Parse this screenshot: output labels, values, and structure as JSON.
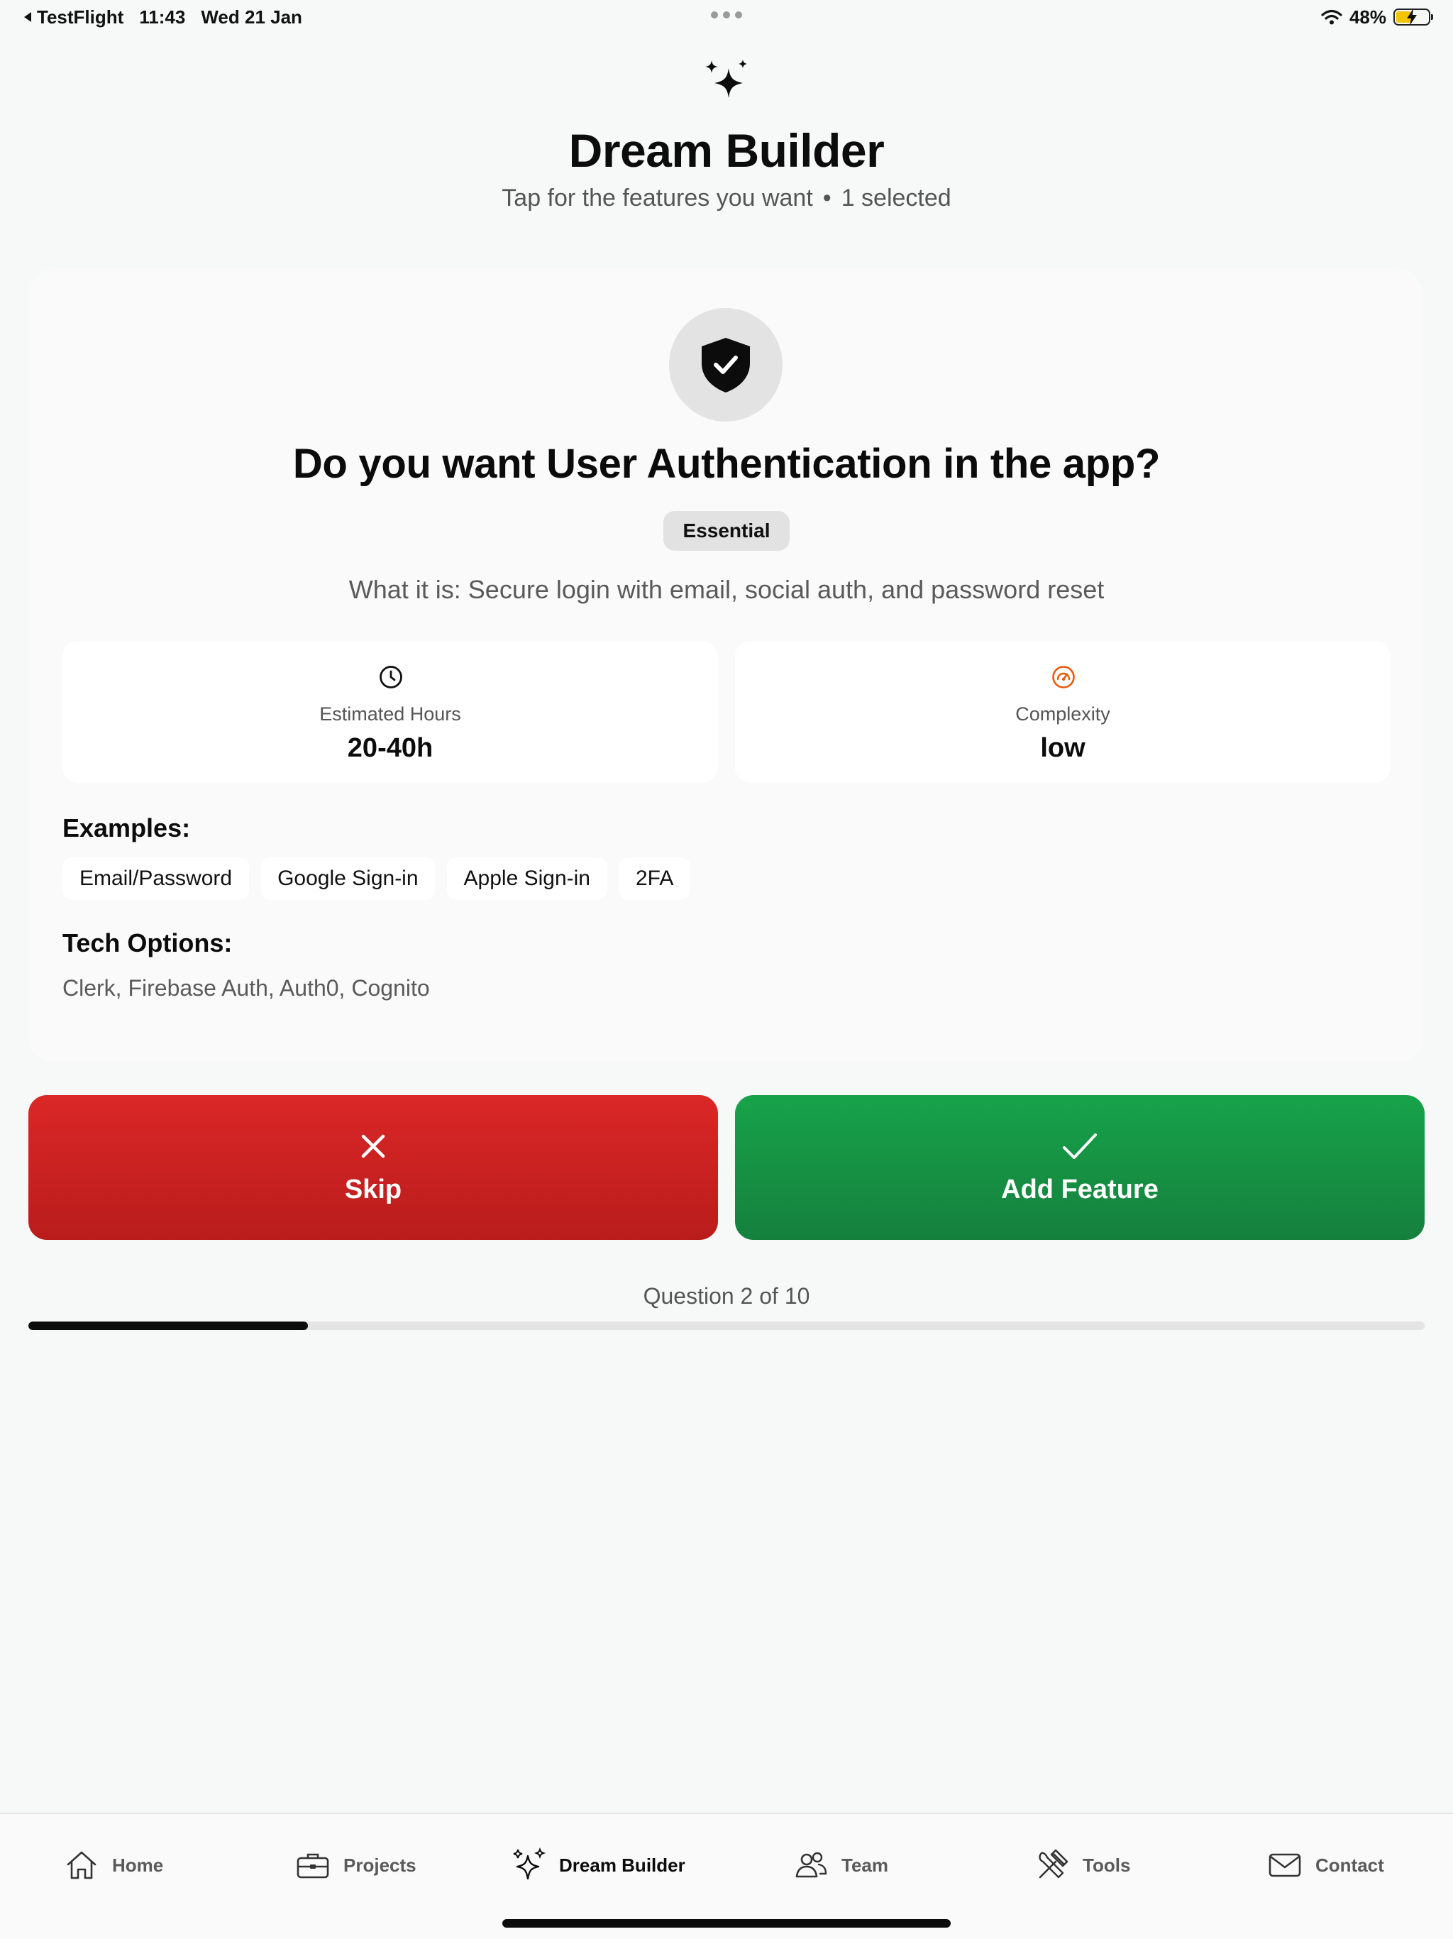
{
  "status_bar": {
    "back_app": "TestFlight",
    "time": "11:43",
    "date": "Wed 21 Jan",
    "battery_percent": "48%",
    "battery_level": 0.48
  },
  "header": {
    "title": "Dream Builder",
    "subtitle_prompt": "Tap for the features you want",
    "separator": "•",
    "selected_count": "1 selected"
  },
  "feature": {
    "icon": "shield-check-icon",
    "question": "Do you want User Authentication in the app?",
    "badge": "Essential",
    "description": "What it is: Secure login with email, social auth, and password reset",
    "stats": {
      "hours_label": "Estimated Hours",
      "hours_value": "20-40h",
      "complexity_label": "Complexity",
      "complexity_value": "low"
    },
    "examples_title": "Examples:",
    "examples": [
      "Email/Password",
      "Google Sign-in",
      "Apple Sign-in",
      "2FA"
    ],
    "tech_title": "Tech Options:",
    "tech_options": "Clerk, Firebase Auth, Auth0, Cognito"
  },
  "actions": {
    "skip_label": "Skip",
    "add_label": "Add Feature"
  },
  "progress": {
    "label": "Question 2 of 10",
    "fraction": 0.2
  },
  "tabs": [
    {
      "label": "Home",
      "icon": "home-icon"
    },
    {
      "label": "Projects",
      "icon": "briefcase-icon"
    },
    {
      "label": "Dream Builder",
      "icon": "sparkles-icon",
      "active": true
    },
    {
      "label": "Team",
      "icon": "people-icon"
    },
    {
      "label": "Tools",
      "icon": "tools-icon"
    },
    {
      "label": "Contact",
      "icon": "envelope-icon"
    }
  ],
  "colors": {
    "skip": "#dc2626",
    "add": "#16a34a",
    "complexity_icon": "#ea580c",
    "text_primary": "#0c0c0c"
  }
}
